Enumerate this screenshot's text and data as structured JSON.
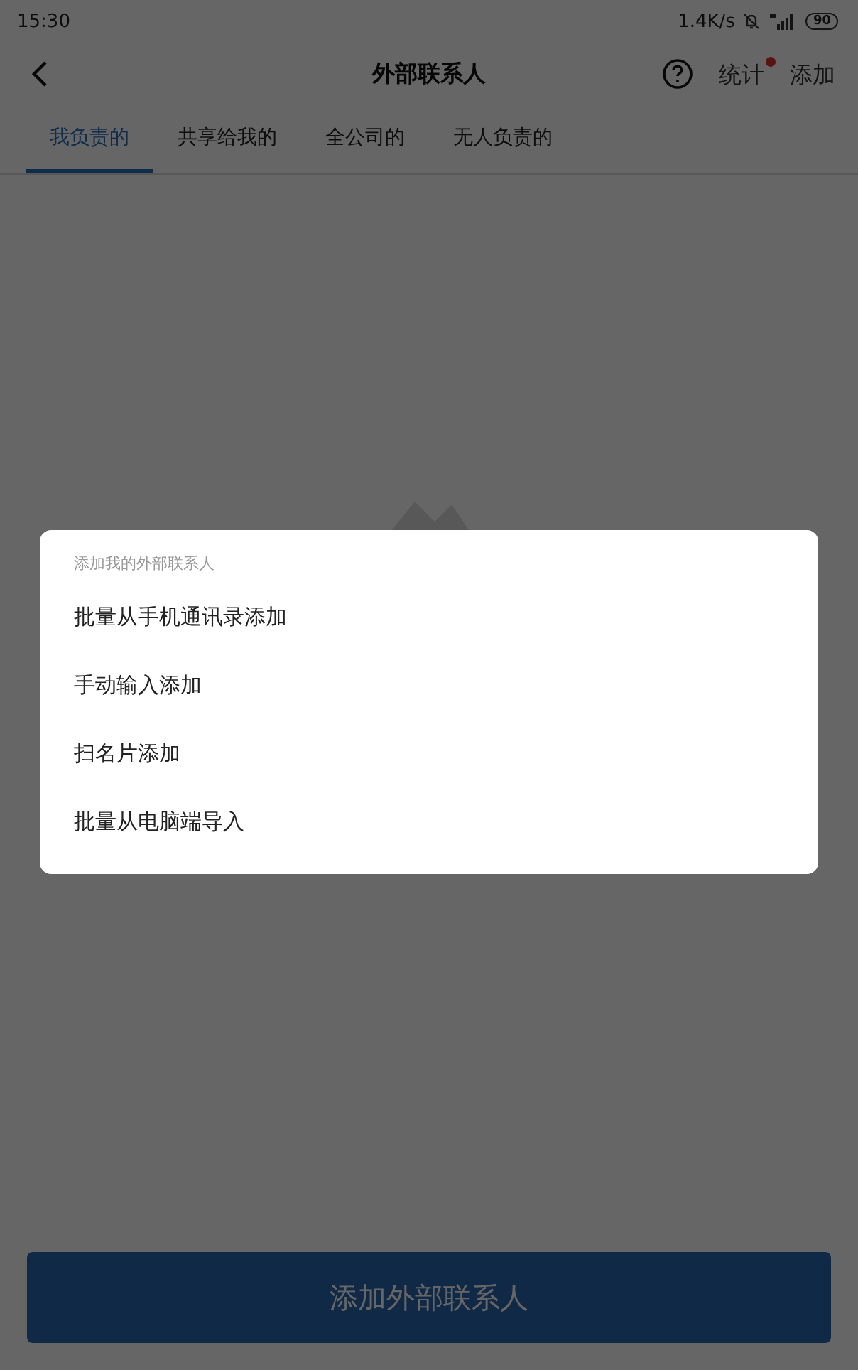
{
  "status_bar": {
    "time": "15:30",
    "speed": "1.4K/s",
    "battery": "90"
  },
  "header": {
    "title": "外部联系人",
    "actions": [
      {
        "label": "统计",
        "badge": true
      },
      {
        "label": "添加",
        "badge": false
      }
    ]
  },
  "tabs": [
    {
      "label": "我负责的",
      "selected": true
    },
    {
      "label": "共享给我的",
      "selected": false
    },
    {
      "label": "全公司的",
      "selected": false
    },
    {
      "label": "无人负责的",
      "selected": false
    }
  ],
  "dialog": {
    "title": "添加我的外部联系人",
    "options": [
      "批量从手机通讯录添加",
      "手动输入添加",
      "扫名片添加",
      "批量从电脑端导入"
    ]
  },
  "bottom_button": "添加外部联系人"
}
